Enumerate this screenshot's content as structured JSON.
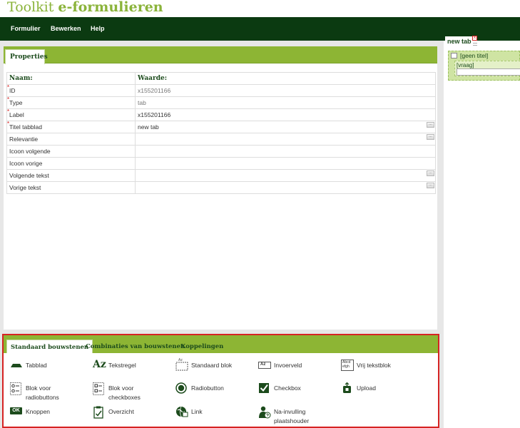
{
  "app": {
    "title_light": "Toolkit ",
    "title_bold": "e-formulieren"
  },
  "menu": {
    "items": [
      "Formulier",
      "Bewerken",
      "Help"
    ]
  },
  "properties": {
    "tab_label": "Properties",
    "col_name": "Naam:",
    "col_value": "Waarde:",
    "rows": [
      {
        "name": "ID",
        "value": "x155201166",
        "required": true,
        "readonly": true,
        "button": false
      },
      {
        "name": "Type",
        "value": "tab",
        "required": true,
        "readonly": true,
        "button": false
      },
      {
        "name": "Label",
        "value": "x155201166",
        "required": true,
        "readonly": false,
        "button": false
      },
      {
        "name": "Titel tabblad",
        "value": "new tab",
        "required": true,
        "readonly": false,
        "button": true
      },
      {
        "name": "Relevantie",
        "value": "",
        "required": false,
        "readonly": false,
        "button": true
      },
      {
        "name": "Icoon volgende",
        "value": "",
        "required": false,
        "readonly": false,
        "button": false
      },
      {
        "name": "Icoon vorige",
        "value": "",
        "required": false,
        "readonly": false,
        "button": false
      },
      {
        "name": "Volgende tekst",
        "value": "",
        "required": false,
        "readonly": false,
        "button": true
      },
      {
        "name": "Vorige tekst",
        "value": "",
        "required": false,
        "readonly": false,
        "button": true
      }
    ],
    "more_button_label": "..."
  },
  "palette": {
    "tabs": [
      "Standaard bouwstenen",
      "Combinaties van bouwstenen",
      "Koppelingen"
    ],
    "items": [
      {
        "label": "Tabblad",
        "icon": "tabblad-icon"
      },
      {
        "label": "Tekstregel",
        "icon": "text-line-icon"
      },
      {
        "label": "Standaard blok",
        "icon": "standard-block-icon"
      },
      {
        "label": "Invoerveld",
        "icon": "input-field-icon"
      },
      {
        "label": "Vrij tekstblok",
        "icon": "free-text-icon"
      },
      {
        "label": "Blok voor radiobuttons",
        "icon": "radio-block-icon"
      },
      {
        "label": "Blok voor checkboxes",
        "icon": "checkbox-block-icon"
      },
      {
        "label": "Radiobutton",
        "icon": "radiobutton-icon"
      },
      {
        "label": "Checkbox",
        "icon": "checkbox-icon"
      },
      {
        "label": "Upload",
        "icon": "upload-icon"
      },
      {
        "label": "Knoppen",
        "icon": "buttons-icon"
      },
      {
        "label": "Overzicht",
        "icon": "overview-icon"
      },
      {
        "label": "Link",
        "icon": "link-icon"
      },
      {
        "label": "Na-invulling plaatshouder",
        "icon": "placeholder-person-icon"
      }
    ],
    "icon_text": {
      "az": "Az",
      "az_small": "Az",
      "ok": "OK",
      "abc": "Abcd efgh"
    }
  },
  "preview": {
    "tab_label": "new tab",
    "close_label": "x",
    "block_title": "[geen titel]",
    "question_label": "[vraag]"
  },
  "colors": {
    "brand_green": "#8ab33a",
    "menubar": "#0b3a11",
    "tabbar": "#8db534",
    "highlight": "#d62323",
    "icon_dark": "#1c4b1c"
  }
}
